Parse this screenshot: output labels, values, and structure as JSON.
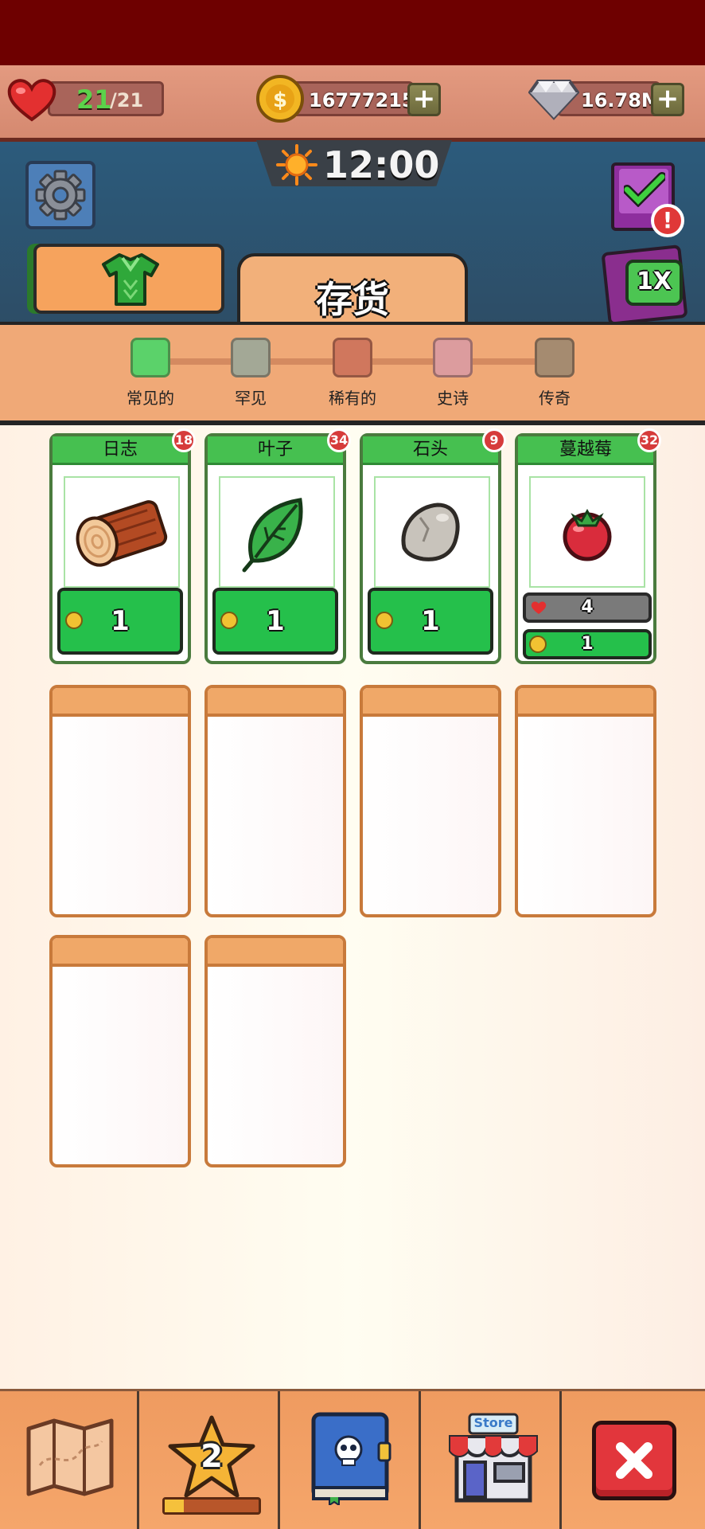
{
  "status": {
    "hearts": "21",
    "hearts_max": "/21",
    "coins": "16777215",
    "gems": "16.78M",
    "time": "12:00"
  },
  "speed_label": "1X",
  "panel": {
    "tab_title": "存货",
    "rarities": [
      {
        "label": "常见的",
        "color": "#5bd26a"
      },
      {
        "label": "罕见",
        "color": "#a3a896"
      },
      {
        "label": "稀有的",
        "color": "#d0775d"
      },
      {
        "label": "史诗",
        "color": "#dc9c9e"
      },
      {
        "label": "传奇",
        "color": "#a58b70"
      }
    ]
  },
  "items": [
    {
      "name": "日志",
      "count": "18",
      "price": "1"
    },
    {
      "name": "叶子",
      "count": "34",
      "price": "1"
    },
    {
      "name": "石头",
      "count": "9",
      "price": "1"
    },
    {
      "name": "蔓越莓",
      "count": "32",
      "heal": "4",
      "price": "1"
    }
  ],
  "nav": {
    "level": "2",
    "store_label": "Store"
  }
}
